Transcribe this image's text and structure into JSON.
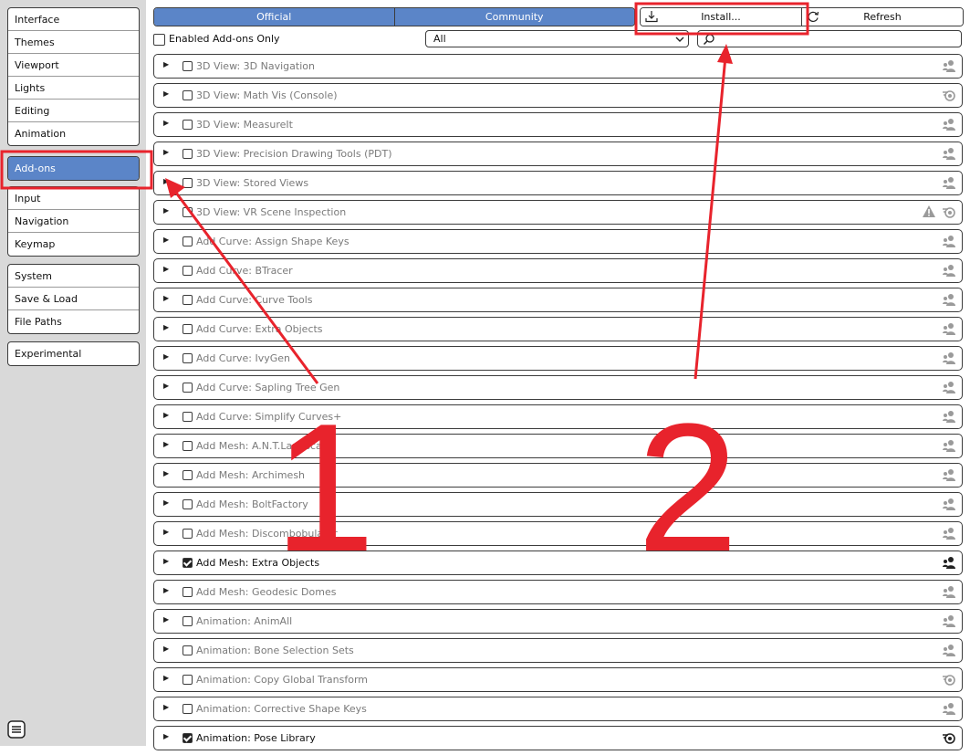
{
  "sidebar": {
    "groups": [
      [
        "Interface",
        "Themes",
        "Viewport",
        "Lights",
        "Editing",
        "Animation"
      ],
      [
        "Add-ons"
      ],
      [
        "Input",
        "Navigation",
        "Keymap"
      ],
      [
        "System",
        "Save & Load",
        "File Paths"
      ],
      [
        "Experimental"
      ]
    ],
    "active": "Add-ons"
  },
  "tabs": [
    "Official",
    "Community"
  ],
  "actions": {
    "install": "Install...",
    "refresh": "Refresh"
  },
  "filter": {
    "enabled_only": "Enabled Add-ons Only",
    "category": "All",
    "search_placeholder": ""
  },
  "addons": [
    {
      "name": "3D View: 3D Navigation",
      "enabled": false,
      "icons": [
        "user-icon"
      ]
    },
    {
      "name": "3D View: Math Vis (Console)",
      "enabled": false,
      "icons": [
        "blender-icon"
      ]
    },
    {
      "name": "3D View: MeasureIt",
      "enabled": false,
      "icons": [
        "user-icon"
      ]
    },
    {
      "name": "3D View: Precision Drawing Tools (PDT)",
      "enabled": false,
      "icons": [
        "user-icon"
      ]
    },
    {
      "name": "3D View: Stored Views",
      "enabled": false,
      "icons": [
        "user-icon"
      ]
    },
    {
      "name": "3D View: VR Scene Inspection",
      "enabled": false,
      "icons": [
        "warning-icon",
        "blender-icon"
      ]
    },
    {
      "name": "Add Curve: Assign Shape Keys",
      "enabled": false,
      "icons": [
        "user-icon"
      ]
    },
    {
      "name": "Add Curve: BTracer",
      "enabled": false,
      "icons": [
        "user-icon"
      ]
    },
    {
      "name": "Add Curve: Curve Tools",
      "enabled": false,
      "icons": [
        "user-icon"
      ]
    },
    {
      "name": "Add Curve: Extra Objects",
      "enabled": false,
      "icons": [
        "user-icon"
      ]
    },
    {
      "name": "Add Curve: IvyGen",
      "enabled": false,
      "icons": [
        "user-icon"
      ]
    },
    {
      "name": "Add Curve: Sapling Tree Gen",
      "enabled": false,
      "icons": [
        "user-icon"
      ]
    },
    {
      "name": "Add Curve: Simplify Curves+",
      "enabled": false,
      "icons": [
        "user-icon"
      ]
    },
    {
      "name": "Add Mesh: A.N.T.Landscape",
      "enabled": false,
      "icons": [
        "user-icon"
      ]
    },
    {
      "name": "Add Mesh: Archimesh",
      "enabled": false,
      "icons": [
        "user-icon"
      ]
    },
    {
      "name": "Add Mesh: BoltFactory",
      "enabled": false,
      "icons": [
        "user-icon"
      ]
    },
    {
      "name": "Add Mesh: Discombobulator",
      "enabled": false,
      "icons": [
        "user-icon"
      ]
    },
    {
      "name": "Add Mesh: Extra Objects",
      "enabled": true,
      "icons": [
        "user-icon"
      ]
    },
    {
      "name": "Add Mesh: Geodesic Domes",
      "enabled": false,
      "icons": [
        "user-icon"
      ]
    },
    {
      "name": "Animation: AnimAll",
      "enabled": false,
      "icons": [
        "user-icon"
      ]
    },
    {
      "name": "Animation: Bone Selection Sets",
      "enabled": false,
      "icons": [
        "user-icon"
      ]
    },
    {
      "name": "Animation: Copy Global Transform",
      "enabled": false,
      "icons": [
        "blender-icon"
      ]
    },
    {
      "name": "Animation: Corrective Shape Keys",
      "enabled": false,
      "icons": [
        "user-icon"
      ]
    },
    {
      "name": "Animation: Pose Library",
      "enabled": true,
      "icons": [
        "blender-icon"
      ]
    }
  ],
  "annotations": {
    "label_1": "1",
    "label_2": "2",
    "color": "#e8232c"
  },
  "colors": {
    "accent": "#5b85c8",
    "sidebar_bg": "#d9d9d9"
  }
}
